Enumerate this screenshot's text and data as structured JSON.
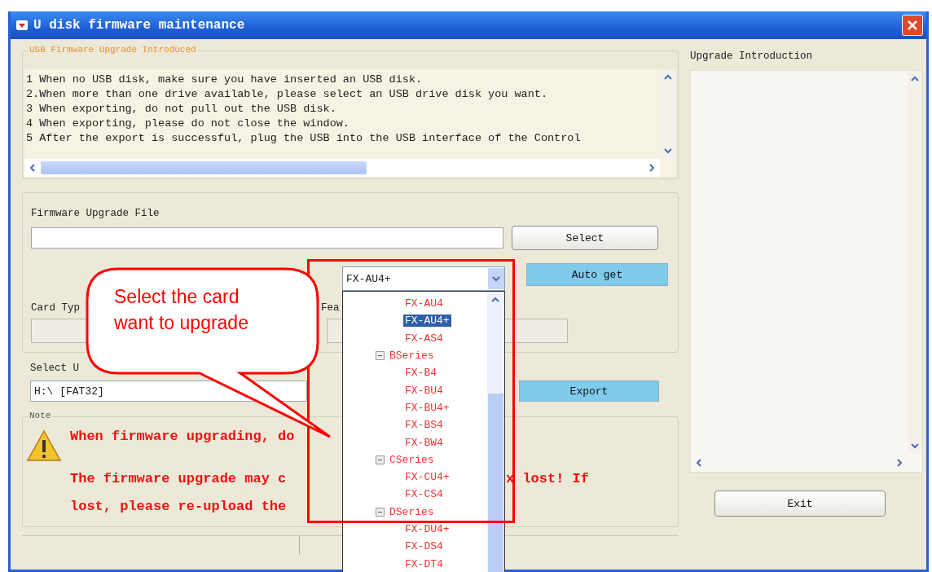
{
  "window": {
    "title": "U disk firmware maintenance"
  },
  "intro": {
    "legend": "USB Firmware Upgrade Introduced",
    "lines": [
      "1 When no USB disk, make sure you have inserted an USB disk.",
      "2.When more than one drive available, please select an USB drive disk you want.",
      "3 When exporting, do not pull out the USB disk.",
      "4 When exporting, please do not close the window.",
      "5 After the export is successful, plug the USB into the USB interface of the Control"
    ]
  },
  "upgrade_file": {
    "label": "Firmware Upgrade File",
    "select_button": "Select",
    "auto_get_button": "Auto get"
  },
  "card_type": {
    "label": "Card Typ",
    "feature_label": "Fea"
  },
  "usb": {
    "label": "Select U",
    "value": "H:\\ [FAT32]",
    "export_button": "Export"
  },
  "note": {
    "legend": "Note",
    "line_1": "When firmware upgrading, do",
    "line_2_left": "The firmware upgrade may c",
    "line_2_right": "x lost! If",
    "line_3": "lost, please re-upload the"
  },
  "right_panel": {
    "label": "Upgrade Introduction",
    "exit_button": "Exit"
  },
  "card_dropdown": {
    "value": "FX-AU4+",
    "tree": [
      {
        "label": "FX-AU4",
        "kind": "leaf",
        "selected": false
      },
      {
        "label": "FX-AU4+",
        "kind": "leaf",
        "selected": true
      },
      {
        "label": "FX-AS4",
        "kind": "leaf",
        "selected": false
      },
      {
        "label": "BSeries",
        "kind": "series",
        "expanded": true,
        "children": [
          {
            "label": "FX-B4",
            "selected": false
          },
          {
            "label": "FX-BU4",
            "selected": false
          },
          {
            "label": "FX-BU4+",
            "selected": false
          },
          {
            "label": "FX-BS4",
            "selected": false
          },
          {
            "label": "FX-BW4",
            "selected": false
          }
        ]
      },
      {
        "label": "CSeries",
        "kind": "series",
        "expanded": true,
        "children": [
          {
            "label": "FX-CU4+",
            "selected": false
          },
          {
            "label": "FX-CS4",
            "selected": false
          }
        ]
      },
      {
        "label": "DSeries",
        "kind": "series",
        "expanded": true,
        "children": [
          {
            "label": "FX-DU4+",
            "selected": false
          },
          {
            "label": "FX-DS4",
            "selected": false
          },
          {
            "label": "FX-DT4",
            "selected": false
          }
        ]
      }
    ]
  },
  "callout": {
    "text": "Select the card want to upgrade"
  }
}
